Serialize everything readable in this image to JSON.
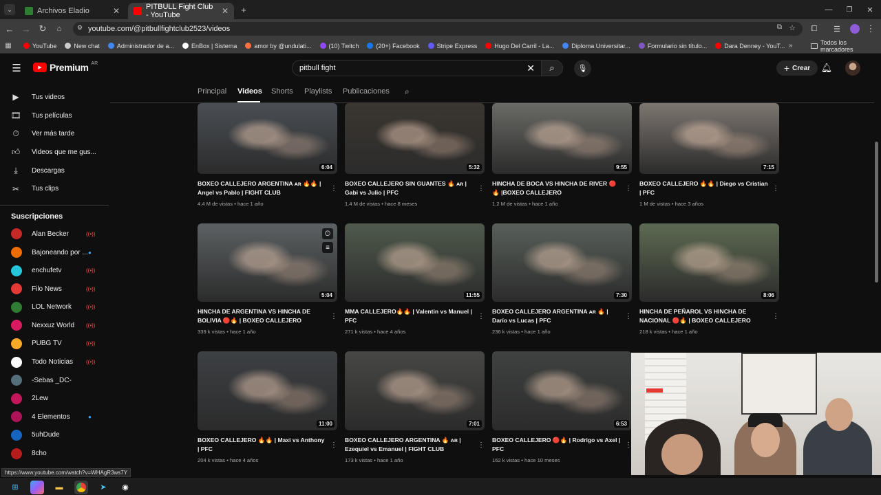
{
  "browser": {
    "tabs": [
      {
        "label": "Archivos Eladio",
        "color": "#2e7d32"
      },
      {
        "label": "PITBULL Fight Club - YouTube",
        "color": "#ff0000"
      }
    ],
    "url": "youtube.com/@pitbullfightclub2523/videos",
    "bookmarks": [
      {
        "label": "YouTube",
        "color": "#ff0000"
      },
      {
        "label": "New chat",
        "color": "#cccccc"
      },
      {
        "label": "Administrador de a...",
        "color": "#4285f4"
      },
      {
        "label": "EnBox | Sistema",
        "color": "#ffffff"
      },
      {
        "label": "amor by @undulati...",
        "color": "#ff7043"
      },
      {
        "label": "(10) Twitch",
        "color": "#9146ff"
      },
      {
        "label": "(20+) Facebook",
        "color": "#1877f2"
      },
      {
        "label": "Stripe Express",
        "color": "#635bff"
      },
      {
        "label": "Hugo Del Carril - La...",
        "color": "#ff0000"
      },
      {
        "label": "Diploma Universitar...",
        "color": "#4285f4"
      },
      {
        "label": "Formulario sin título...",
        "color": "#7e57c2"
      },
      {
        "label": "Dara Denney - YouT...",
        "color": "#ff0000"
      }
    ],
    "all_bookmarks": "Todos los marcadores",
    "status_url": "https://www.youtube.com/watch?v=WHAgR3ws7Y"
  },
  "youtube": {
    "logo": "Premium",
    "logo_region": "AR",
    "search_value": "pitbull fight",
    "create_label": "Crear"
  },
  "sidebar": {
    "items": [
      {
        "label": "Tus videos",
        "icon": "play-square-icon"
      },
      {
        "label": "Tus películas",
        "icon": "film-icon"
      },
      {
        "label": "Ver más tarde",
        "icon": "clock-icon"
      },
      {
        "label": "Videos que me gus...",
        "icon": "thumb-up-icon"
      },
      {
        "label": "Descargas",
        "icon": "download-icon"
      },
      {
        "label": "Tus clips",
        "icon": "scissors-icon"
      }
    ],
    "subs_heading": "Suscripciones",
    "subscriptions": [
      {
        "name": "Alan Becker",
        "color": "#c62828",
        "badge": "live"
      },
      {
        "name": "Bajoneando por ...",
        "color": "#ef6c00",
        "badge": "dot"
      },
      {
        "name": "enchufetv",
        "color": "#26c6da",
        "badge": "live"
      },
      {
        "name": "Filo News",
        "color": "#e53935",
        "badge": "live"
      },
      {
        "name": "LOL Network",
        "color": "#2e7d32",
        "badge": "live"
      },
      {
        "name": "Nexxuz World",
        "color": "#d81b60",
        "badge": "live"
      },
      {
        "name": "PUBG TV",
        "color": "#f9a825",
        "badge": "live"
      },
      {
        "name": "Todo Noticias",
        "color": "#ffffff",
        "badge": "live"
      },
      {
        "name": "-Sebas _DC-",
        "color": "#546e7a",
        "badge": ""
      },
      {
        "name": "2Lew",
        "color": "#c2185b",
        "badge": ""
      },
      {
        "name": "4 Elementos",
        "color": "#ad1457",
        "badge": "dot"
      },
      {
        "name": "5uhDude",
        "color": "#1565c0",
        "badge": ""
      },
      {
        "name": "8cho",
        "color": "#b71c1c",
        "badge": ""
      }
    ]
  },
  "channel_tabs": [
    "Principal",
    "Videos",
    "Shorts",
    "Playlists",
    "Publicaciones"
  ],
  "videos": [
    {
      "title": "BOXEO CALLEJERO ARGENTINA ᴀʀ 🔥🔥 | Angel vs Pablo | FIGHT CLUB",
      "views": "4.4 M de vistas",
      "age": "hace 1 año",
      "duration": "6:04",
      "tone": "#4a4f55"
    },
    {
      "title": "BOXEO CALLEJERO SIN GUANTES 🔥 ᴀʀ | Gabi vs Julio | PFC",
      "views": "1.4 M de vistas",
      "age": "hace 8 meses",
      "duration": "5:32",
      "tone": "#3b3630"
    },
    {
      "title": "HINCHA DE BOCA VS HINCHA DE RIVER 🔴🔥 |BOXEO CALLEJERO",
      "views": "1.2 M de vistas",
      "age": "hace 1 año",
      "duration": "9:55",
      "tone": "#6a6a66"
    },
    {
      "title": "BOXEO CALLEJERO 🔥🔥 | Diego vs Cristian | PFC",
      "views": "1 M de vistas",
      "age": "hace 3 años",
      "duration": "7:15",
      "tone": "#7d7670"
    },
    {
      "title": "HINCHA DE ARGENTINA VS HINCHA DE BOLIVIA 🔴🔥 | BOXEO CALLEJERO",
      "views": "339 k vistas",
      "age": "hace 1 año",
      "duration": "5:04",
      "tone": "#5c6163"
    },
    {
      "title": "MMA CALLEJERO🔥🔥 | Valentin vs Manuel | PFC",
      "views": "271 k vistas",
      "age": "hace 4 años",
      "duration": "11:55",
      "tone": "#4f5a4c"
    },
    {
      "title": "BOXEO CALLEJERO ARGENTINA ᴀʀ 🔥 | Darío vs Lucas | PFC",
      "views": "236 k vistas",
      "age": "hace 1 año",
      "duration": "7:30",
      "tone": "#58605a"
    },
    {
      "title": "HINCHA DE PEÑAROL VS HINCHA DE NACIONAL 🔴🔥 | BOXEO CALLEJERO",
      "views": "218 k vistas",
      "age": "hace 1 año",
      "duration": "8:06",
      "tone": "#5d6a52"
    },
    {
      "title": "BOXEO CALLEJERO 🔥🔥 | Maxi vs Anthony | PFC",
      "views": "204 k vistas",
      "age": "hace 4 años",
      "duration": "11:00",
      "tone": "#3d4044"
    },
    {
      "title": "BOXEO CALLEJERO ARGENTINA 🔥 ᴀʀ | Ezequiel vs Emanuel | FIGHT CLUB",
      "views": "173 k vistas",
      "age": "hace 1 año",
      "duration": "7:01",
      "tone": "#474845"
    },
    {
      "title": "BOXEO CALLEJERO 🔴🔥 | Rodrigo vs Axel | PFC",
      "views": "162 k vistas",
      "age": "hace 10 meses",
      "duration": "6:53",
      "tone": "#3f4240"
    }
  ]
}
